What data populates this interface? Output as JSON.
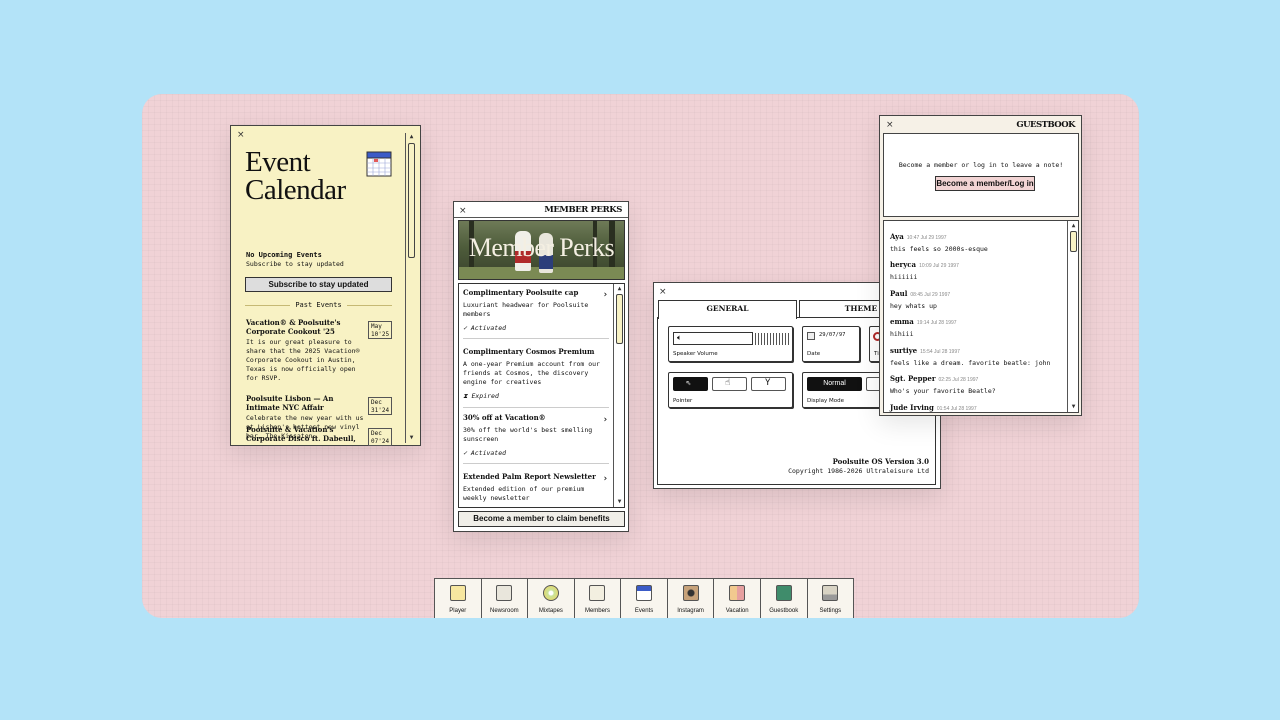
{
  "events": {
    "title_line1": "Event",
    "title_line2": "Calendar",
    "no_upcoming": "No Upcoming Events",
    "subscribe_text": "Subscribe to stay updated",
    "subscribe_button": "Subscribe to stay updated",
    "past_label": "Past Events",
    "items": [
      {
        "title": "Vacation® & Poolsuite's Corporate Cookout '25",
        "desc": "It is our great pleasure to share that the 2025 Vacation® Corporate Cookout in Austin, Texas is now officially open for RSVP.",
        "month": "May",
        "day": "10'25"
      },
      {
        "title": "Poolsuite Lisbon — An Intimate NYC Affair",
        "desc": "Celebrate the new year with us at Lisbon's hottest new vinyl bar, The Kissaten.",
        "month": "Dec",
        "day": "31'24"
      },
      {
        "title": "Poolsuite & Vacation's Corporate Disco ft. Dabeull,",
        "desc": "",
        "month": "Dec",
        "day": "07'24"
      }
    ]
  },
  "perks": {
    "window_title": "MEMBER PERKS",
    "banner_text": "Member Perks",
    "items": [
      {
        "title": "Complimentary Poolsuite cap",
        "desc": "Luxuriant headwear for Poolsuite members",
        "status": "Activated",
        "status_icon": "check-icon"
      },
      {
        "title": "Complimentary Cosmos Premium",
        "desc": "A one-year Premium account from our friends at Cosmos, the discovery engine for creatives",
        "status": "Expired",
        "status_icon": "hourglass-icon"
      },
      {
        "title": "30% off at Vacation®",
        "desc": "30% off the world's best smelling sunscreen",
        "status": "Activated",
        "status_icon": "check-icon"
      },
      {
        "title": "Extended Palm Report Newsletter",
        "desc": "Extended edition of our premium weekly newsletter",
        "status": "",
        "status_icon": ""
      }
    ],
    "claim_button": "Become a member to claim benefits"
  },
  "settings": {
    "tabs": [
      "GENERAL",
      "THEME"
    ],
    "volume_label": "Speaker Volume",
    "date_value": "29/07/97",
    "date_label": "Date",
    "time_label_partial": "Ti",
    "pointer_label": "Pointer",
    "display_mode_label": "Display Mode",
    "display_mode_value": "Normal",
    "version": "Poolsuite OS Version 3.0",
    "copyright": "Copyright 1986-2026 Ultraleisure Ltd"
  },
  "guestbook": {
    "window_title": "GUESTBOOK",
    "prompt": "Become a member or log in to leave a note!",
    "login_button": "Become a member/Log in",
    "entries": [
      {
        "name": "Aya",
        "time": "10:47 Jul 29 1997",
        "msg": "this feels so 2000s-esque"
      },
      {
        "name": "heryca",
        "time": "10:09 Jul 29 1997",
        "msg": "hiiiiii"
      },
      {
        "name": "Paul",
        "time": "08:45 Jul 29 1997",
        "msg": "hey whats up"
      },
      {
        "name": "emma",
        "time": "19:14 Jul 28 1997",
        "msg": "hihiii"
      },
      {
        "name": "surtiye",
        "time": "15:54 Jul 28 1997",
        "msg": "feels like a dream. favorite beatle: john"
      },
      {
        "name": "Sgt. Pepper",
        "time": "02:25 Jul 28 1997",
        "msg": "Who's your favorite Beatle?"
      },
      {
        "name": "Jude Irving",
        "time": "01:54 Jul 28 1997",
        "msg": "hiii"
      }
    ]
  },
  "dock": [
    {
      "label": "Player",
      "icon": "cocktail-icon"
    },
    {
      "label": "Newsroom",
      "icon": "typewriter-icon"
    },
    {
      "label": "Mixtapes",
      "icon": "cd-icon"
    },
    {
      "label": "Members",
      "icon": "member-card-icon"
    },
    {
      "label": "Events",
      "icon": "calendar-icon"
    },
    {
      "label": "Instagram",
      "icon": "camera-icon"
    },
    {
      "label": "Vacation",
      "icon": "sunscreen-icon"
    },
    {
      "label": "Guestbook",
      "icon": "book-icon"
    },
    {
      "label": "Settings",
      "icon": "computer-icon"
    }
  ],
  "colors": {
    "background": "#b3e3f8",
    "desktop": "#f0d2d6",
    "calendar_window": "#f8f2c4",
    "login_button": "#f2d4d4"
  }
}
